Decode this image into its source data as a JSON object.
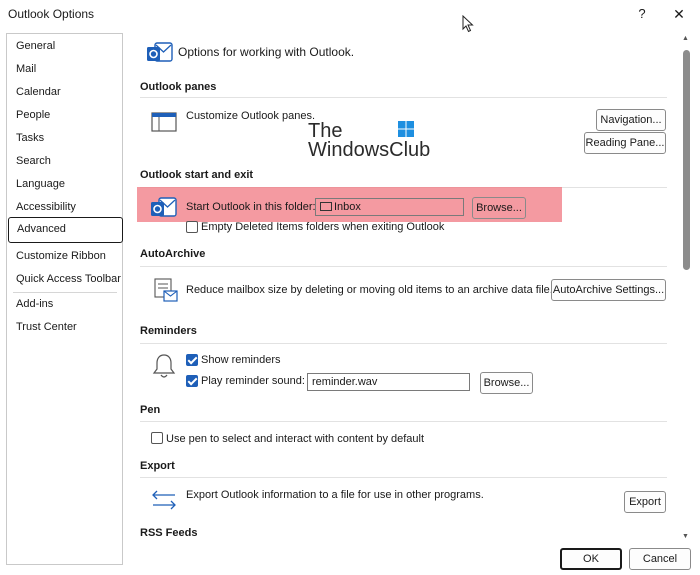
{
  "window": {
    "title": "Outlook Options",
    "help": "?",
    "close": "✕"
  },
  "sidebar": {
    "items": [
      {
        "label": "General"
      },
      {
        "label": "Mail"
      },
      {
        "label": "Calendar"
      },
      {
        "label": "People"
      },
      {
        "label": "Tasks"
      },
      {
        "label": "Search"
      },
      {
        "label": "Language"
      },
      {
        "label": "Accessibility"
      },
      {
        "label": "Advanced",
        "selected": true
      },
      {
        "label": "Customize Ribbon"
      },
      {
        "label": "Quick Access Toolbar"
      },
      {
        "label": "Add-ins"
      },
      {
        "label": "Trust Center"
      }
    ]
  },
  "header": {
    "text": "Options for working with Outlook."
  },
  "watermark": {
    "line1": "The",
    "line2": "WindowsClub"
  },
  "panes": {
    "title": "Outlook panes",
    "description": "Customize Outlook panes.",
    "navigation_button": "Navigation...",
    "reading_pane_button": "Reading Pane..."
  },
  "start_exit": {
    "title": "Outlook start and exit",
    "start_label": "Start Outlook in this folder:",
    "folder_value": "Inbox",
    "browse_button": "Browse...",
    "empty_deleted_label": "Empty Deleted Items folders when exiting Outlook",
    "empty_deleted_checked": false
  },
  "autoarchive": {
    "title": "AutoArchive",
    "description": "Reduce mailbox size by deleting or moving old items to an archive data file.",
    "settings_button": "AutoArchive Settings..."
  },
  "reminders": {
    "title": "Reminders",
    "show_label": "Show reminders",
    "show_checked": true,
    "play_label": "Play reminder sound:",
    "play_checked": true,
    "sound_value": "reminder.wav",
    "browse_button": "Browse..."
  },
  "pen": {
    "title": "Pen",
    "pen_label": "Use pen to select and interact with content by default",
    "pen_checked": false
  },
  "export": {
    "title": "Export",
    "description": "Export Outlook information to a file for use in other programs.",
    "export_button": "Export"
  },
  "rss": {
    "title": "RSS Feeds"
  },
  "footer": {
    "ok_button": "OK",
    "cancel_button": "Cancel"
  },
  "colors": {
    "accent": "#1e5fb8",
    "highlight": "#f07882"
  }
}
